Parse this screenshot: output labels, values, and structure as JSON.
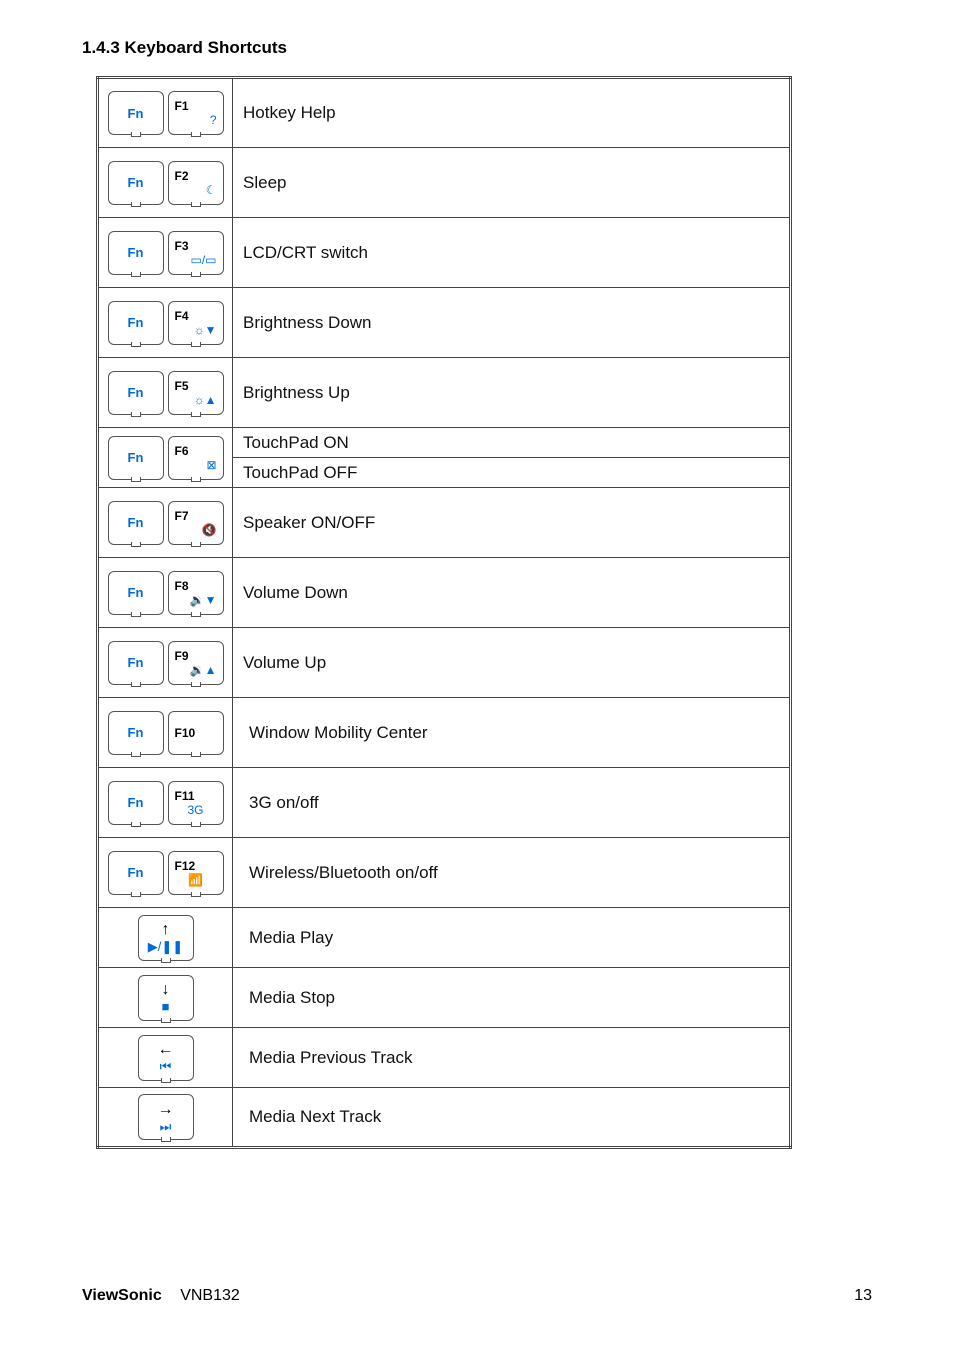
{
  "heading": "1.4.3 Keyboard Shortcuts",
  "rows": [
    {
      "fn": "Fn",
      "fkey": "F1",
      "icon": "?",
      "desc": "Hotkey Help"
    },
    {
      "fn": "Fn",
      "fkey": "F2",
      "icon": "☾",
      "desc": "Sleep"
    },
    {
      "fn": "Fn",
      "fkey": "F3",
      "icon": "▭/▭",
      "desc": "LCD/CRT switch"
    },
    {
      "fn": "Fn",
      "fkey": "F4",
      "icon": "☼▼",
      "desc": "Brightness Down"
    },
    {
      "fn": "Fn",
      "fkey": "F5",
      "icon": "☼▲",
      "desc": "Brightness Up"
    },
    {
      "fn": "Fn",
      "fkey": "F6",
      "icon": "⊠",
      "desc_a": "TouchPad ON",
      "desc_b": "TouchPad OFF"
    },
    {
      "fn": "Fn",
      "fkey": "F7",
      "icon": "🔇",
      "desc": "Speaker ON/OFF"
    },
    {
      "fn": "Fn",
      "fkey": "F8",
      "icon": "🔉▼",
      "desc": "Volume Down"
    },
    {
      "fn": "Fn",
      "fkey": "F9",
      "icon": "🔉▲",
      "desc": "Volume Up"
    },
    {
      "fn": "Fn",
      "fkey": "F10",
      "icon": "",
      "desc": "Window Mobility Center"
    },
    {
      "fn": "Fn",
      "fkey": "F11",
      "icon": "3G",
      "desc": "3G on/off"
    },
    {
      "fn": "Fn",
      "fkey": "F12",
      "icon": "📶",
      "desc": "Wireless/Bluetooth on/off"
    }
  ],
  "media_rows": [
    {
      "arrow": "↑",
      "media": "▶/❚❚",
      "desc": "Media Play"
    },
    {
      "arrow": "↓",
      "media": "■",
      "desc": "Media Stop"
    },
    {
      "arrow": "←",
      "media": "⏮",
      "desc": "Media Previous Track"
    },
    {
      "arrow": "→",
      "media": "⏭",
      "desc": "Media Next Track"
    }
  ],
  "footer": {
    "brand": "ViewSonic",
    "model": "VNB132",
    "page": "13"
  }
}
